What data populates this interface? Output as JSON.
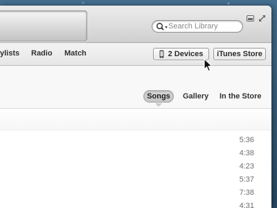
{
  "toolbar": {
    "search": {
      "placeholder": "Search Library",
      "value": ""
    }
  },
  "nav": {
    "items": [
      {
        "label": "ylists"
      },
      {
        "label": "Radio"
      },
      {
        "label": "Match"
      }
    ],
    "devices_label": "2 Devices",
    "store_label": "iTunes Store"
  },
  "segments": {
    "selected": "Songs",
    "items": [
      {
        "label": "Gallery"
      },
      {
        "label": "In the Store"
      }
    ]
  },
  "songs": [
    {
      "duration": "5:36"
    },
    {
      "duration": "4:38"
    },
    {
      "duration": "4:23"
    },
    {
      "duration": "5:37"
    },
    {
      "duration": "7:38"
    },
    {
      "duration": "4:31"
    }
  ],
  "colors": {
    "desktop_background": "#2f536f",
    "window_background": "#f7f7f7",
    "toolbar_gradient_top": "#ececec",
    "selected_segment": "#cfcfcf"
  },
  "icons": {
    "search": "search-icon",
    "device": "iphone-icon",
    "fullscreen": "fullscreen-icon",
    "miniplayer": "miniplayer-icon",
    "cursor": "mouse-cursor-icon"
  }
}
